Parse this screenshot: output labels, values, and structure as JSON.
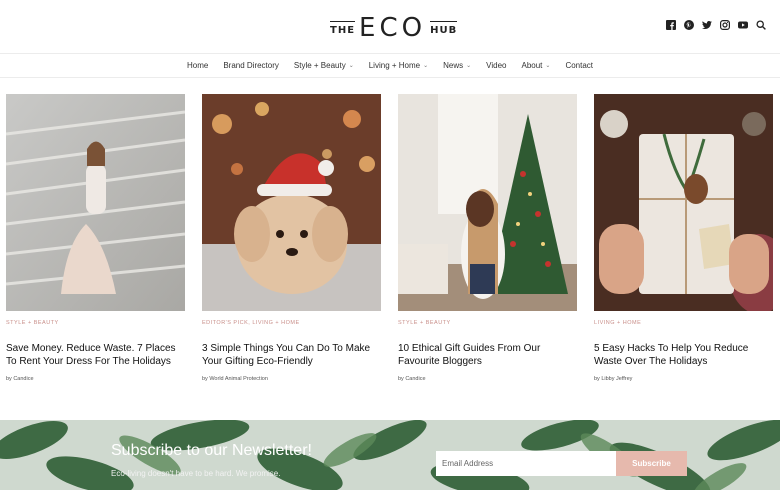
{
  "logo": {
    "the": "THE",
    "eco": "ECO",
    "hub": "HUB"
  },
  "social": [
    "facebook-icon",
    "pinterest-icon",
    "twitter-icon",
    "instagram-icon",
    "youtube-icon",
    "search-icon"
  ],
  "nav": [
    {
      "label": "Home",
      "dropdown": false
    },
    {
      "label": "Brand Directory",
      "dropdown": false
    },
    {
      "label": "Style + Beauty",
      "dropdown": true
    },
    {
      "label": "Living + Home",
      "dropdown": true
    },
    {
      "label": "News",
      "dropdown": true
    },
    {
      "label": "Video",
      "dropdown": false
    },
    {
      "label": "About",
      "dropdown": true
    },
    {
      "label": "Contact",
      "dropdown": false
    }
  ],
  "articles": [
    {
      "category": "STYLE + BEAUTY",
      "title": "Save Money. Reduce Waste. 7 Places To Rent Your Dress For The Holidays",
      "byline": "by Candice"
    },
    {
      "category": "EDITOR'S PICK, LIVING + HOME",
      "title": "3 Simple Things You Can Do To Make Your Gifting Eco-Friendly",
      "byline": "by World Animal Protection"
    },
    {
      "category": "STYLE + BEAUTY",
      "title": "10 Ethical Gift Guides From Our Favourite Bloggers",
      "byline": "by Candice"
    },
    {
      "category": "LIVING + HOME",
      "title": "5 Easy Hacks To Help You Reduce Waste Over The Holidays",
      "byline": "by Libby Jeffrey"
    }
  ],
  "newsletter": {
    "title": "Subscribe to our Newsletter!",
    "subtitle": "Eco-living doesn't have to be hard. We promise.",
    "email_placeholder": "Email Address",
    "button_label": "Subscribe"
  },
  "colors": {
    "accent": "#e6b9ad",
    "category": "#c98f8a"
  }
}
